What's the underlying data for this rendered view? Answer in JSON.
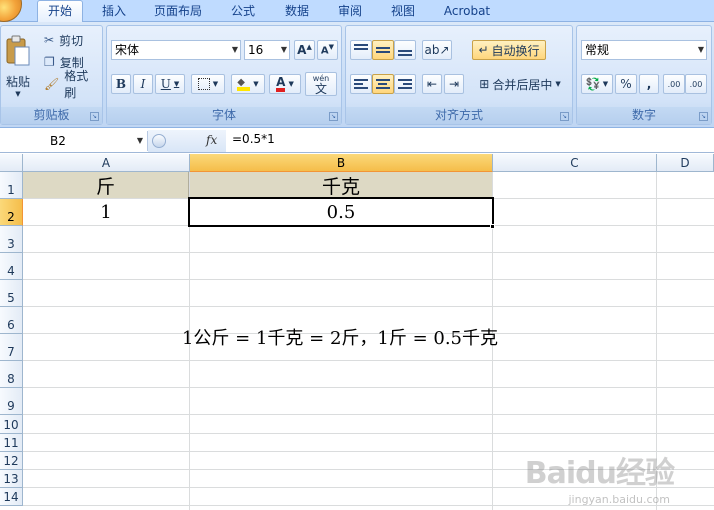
{
  "ribbon": {
    "tabs": [
      "开始",
      "插入",
      "页面布局",
      "公式",
      "数据",
      "审阅",
      "视图",
      "Acrobat"
    ],
    "clipboard": {
      "paste": "粘贴",
      "cut": "剪切",
      "copy": "复制",
      "format_painter": "格式刷",
      "label": "剪贴板"
    },
    "font": {
      "name": "宋体",
      "size": "16",
      "bold": "B",
      "italic": "I",
      "underline": "U",
      "label": "字体",
      "phonetic": "wén",
      "phonetic_char": "文"
    },
    "alignment": {
      "wrap_text": "自动换行",
      "merge_center": "合并后居中",
      "label": "对齐方式"
    },
    "number": {
      "format": "常规",
      "percent": "%",
      "comma": ",",
      "inc_decimal": ".00",
      "dec_decimal": ".00",
      "label": "数字"
    }
  },
  "formula_bar": {
    "name_box": "B2",
    "fx": "fx",
    "formula": "=0.5*1"
  },
  "sheet": {
    "columns": [
      "A",
      "B",
      "C",
      "D"
    ],
    "rows": [
      "1",
      "2",
      "3",
      "4",
      "5",
      "6",
      "7",
      "8",
      "9",
      "10",
      "11",
      "12",
      "13",
      "14"
    ],
    "cells": {
      "A1": "斤",
      "B1": "千克",
      "A2": "1",
      "B2": "0.5"
    },
    "note": "1公斤 = 1千克 = 2斤，1斤 = 0.5千克",
    "selected_cell": "B2"
  },
  "watermark": {
    "text": "Baidu经验",
    "url": "jingyan.baidu.com"
  },
  "colors": {
    "header_fill": "#ddd9c4",
    "selected_header": "#f5bd4a",
    "ribbon_bg": "#c5dbf6"
  }
}
